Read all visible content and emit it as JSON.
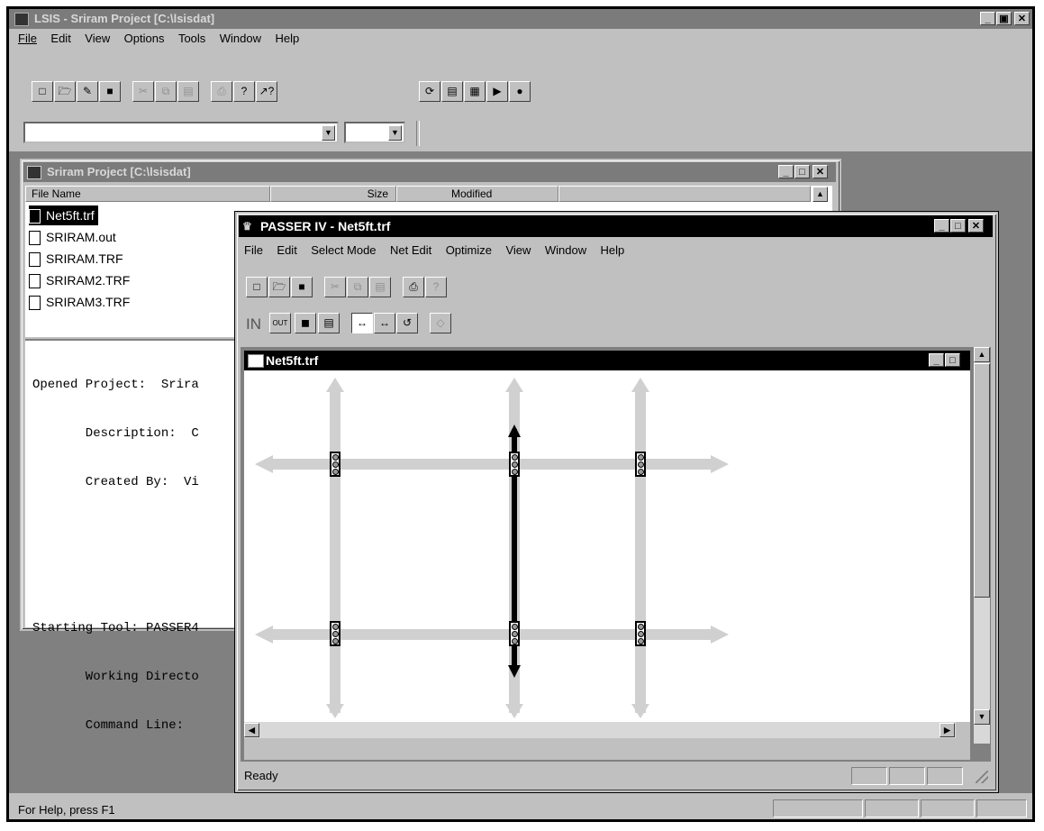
{
  "lsis": {
    "title": "LSIS - Sriram Project  [C:\\lsisdat]",
    "menu": [
      "File",
      "Edit",
      "View",
      "Options",
      "Tools",
      "Window",
      "Help"
    ],
    "status": "For Help, press F1"
  },
  "project": {
    "title": "Sriram Project  [C:\\lsisdat]",
    "columns": {
      "name": "File Name",
      "size": "Size",
      "modified": "Modified"
    },
    "files": [
      "Net5ft.trf",
      "SRIRAM.out",
      "SRIRAM.TRF",
      "SRIRAM2.TRF",
      "SRIRAM3.TRF"
    ],
    "log": [
      "Opened Project:  Srira",
      "       Description:  C",
      "       Created By:  Vi",
      "",
      "",
      "Starting Tool: PASSER4",
      "       Working Directo",
      "       Command Line:"
    ]
  },
  "passer": {
    "title": "PASSER IV - Net5ft.trf",
    "menu": [
      "File",
      "Edit",
      "Select Mode",
      "Net Edit",
      "Optimize",
      "View",
      "Window",
      "Help"
    ],
    "toolbar2": {
      "in_label": "IN",
      "out_label": "OUT"
    },
    "doc_title": "Net5ft.trf",
    "status": "Ready"
  }
}
